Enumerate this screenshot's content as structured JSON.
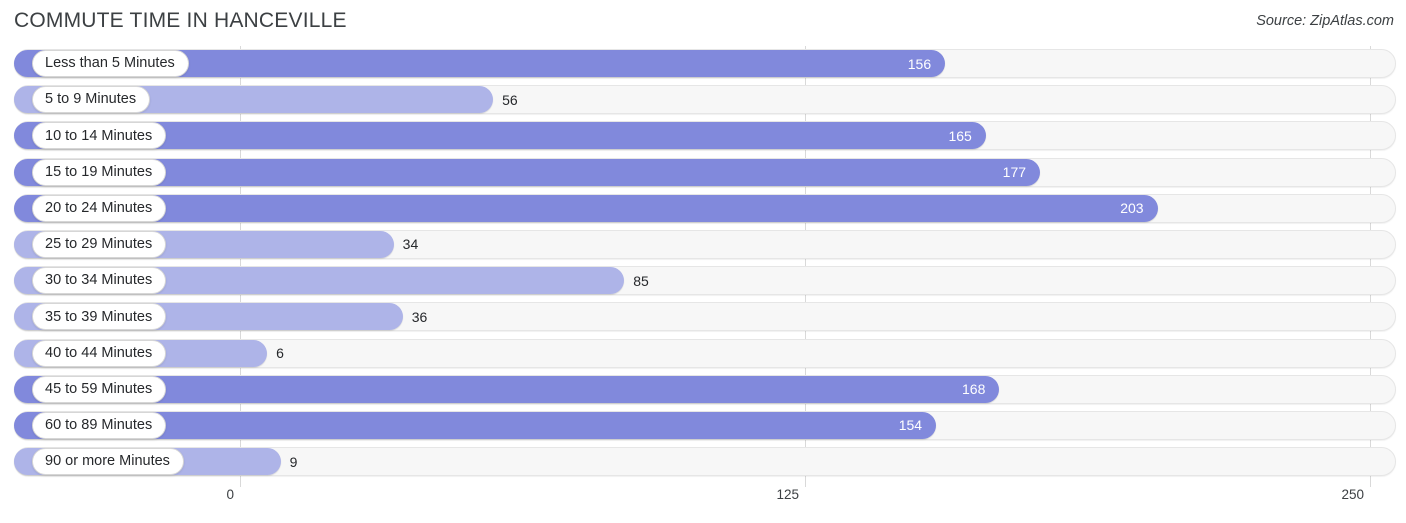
{
  "header": {
    "title": "COMMUTE TIME IN HANCEVILLE",
    "source": "Source: ZipAtlas.com"
  },
  "colors": {
    "bar_dark": "#8189dc",
    "bar_light": "#aeb4e8",
    "track": "#f7f7f7",
    "gridline": "#d9d9d9",
    "text": "#26282b"
  },
  "chart_data": {
    "type": "bar",
    "orientation": "horizontal",
    "title": "COMMUTE TIME IN HANCEVILLE",
    "xlabel": "",
    "ylabel": "",
    "xlim": [
      0,
      250
    ],
    "ticks": [
      "0",
      "125",
      "250"
    ],
    "tick_values": [
      0,
      125,
      250
    ],
    "grid": true,
    "legend": null,
    "categories": [
      "Less than 5 Minutes",
      "5 to 9 Minutes",
      "10 to 14 Minutes",
      "15 to 19 Minutes",
      "20 to 24 Minutes",
      "25 to 29 Minutes",
      "30 to 34 Minutes",
      "35 to 39 Minutes",
      "40 to 44 Minutes",
      "45 to 59 Minutes",
      "60 to 89 Minutes",
      "90 or more Minutes"
    ],
    "values": [
      156,
      56,
      165,
      177,
      203,
      34,
      85,
      36,
      6,
      168,
      154,
      9
    ],
    "bars": [
      {
        "label": "Less than 5 Minutes",
        "value": 156,
        "value_text": "156",
        "shade": "dark",
        "label_inside": true
      },
      {
        "label": "5 to 9 Minutes",
        "value": 56,
        "value_text": "56",
        "shade": "light",
        "label_inside": false
      },
      {
        "label": "10 to 14 Minutes",
        "value": 165,
        "value_text": "165",
        "shade": "dark",
        "label_inside": true
      },
      {
        "label": "15 to 19 Minutes",
        "value": 177,
        "value_text": "177",
        "shade": "dark",
        "label_inside": true
      },
      {
        "label": "20 to 24 Minutes",
        "value": 203,
        "value_text": "203",
        "shade": "dark",
        "label_inside": true
      },
      {
        "label": "25 to 29 Minutes",
        "value": 34,
        "value_text": "34",
        "shade": "light",
        "label_inside": false
      },
      {
        "label": "30 to 34 Minutes",
        "value": 85,
        "value_text": "85",
        "shade": "light",
        "label_inside": false
      },
      {
        "label": "35 to 39 Minutes",
        "value": 36,
        "value_text": "36",
        "shade": "light",
        "label_inside": false
      },
      {
        "label": "40 to 44 Minutes",
        "value": 6,
        "value_text": "6",
        "shade": "light",
        "label_inside": false
      },
      {
        "label": "45 to 59 Minutes",
        "value": 168,
        "value_text": "168",
        "shade": "dark",
        "label_inside": true
      },
      {
        "label": "60 to 89 Minutes",
        "value": 154,
        "value_text": "154",
        "shade": "dark",
        "label_inside": true
      },
      {
        "label": "90 or more Minutes",
        "value": 9,
        "value_text": "9",
        "shade": "light",
        "label_inside": false
      }
    ]
  }
}
